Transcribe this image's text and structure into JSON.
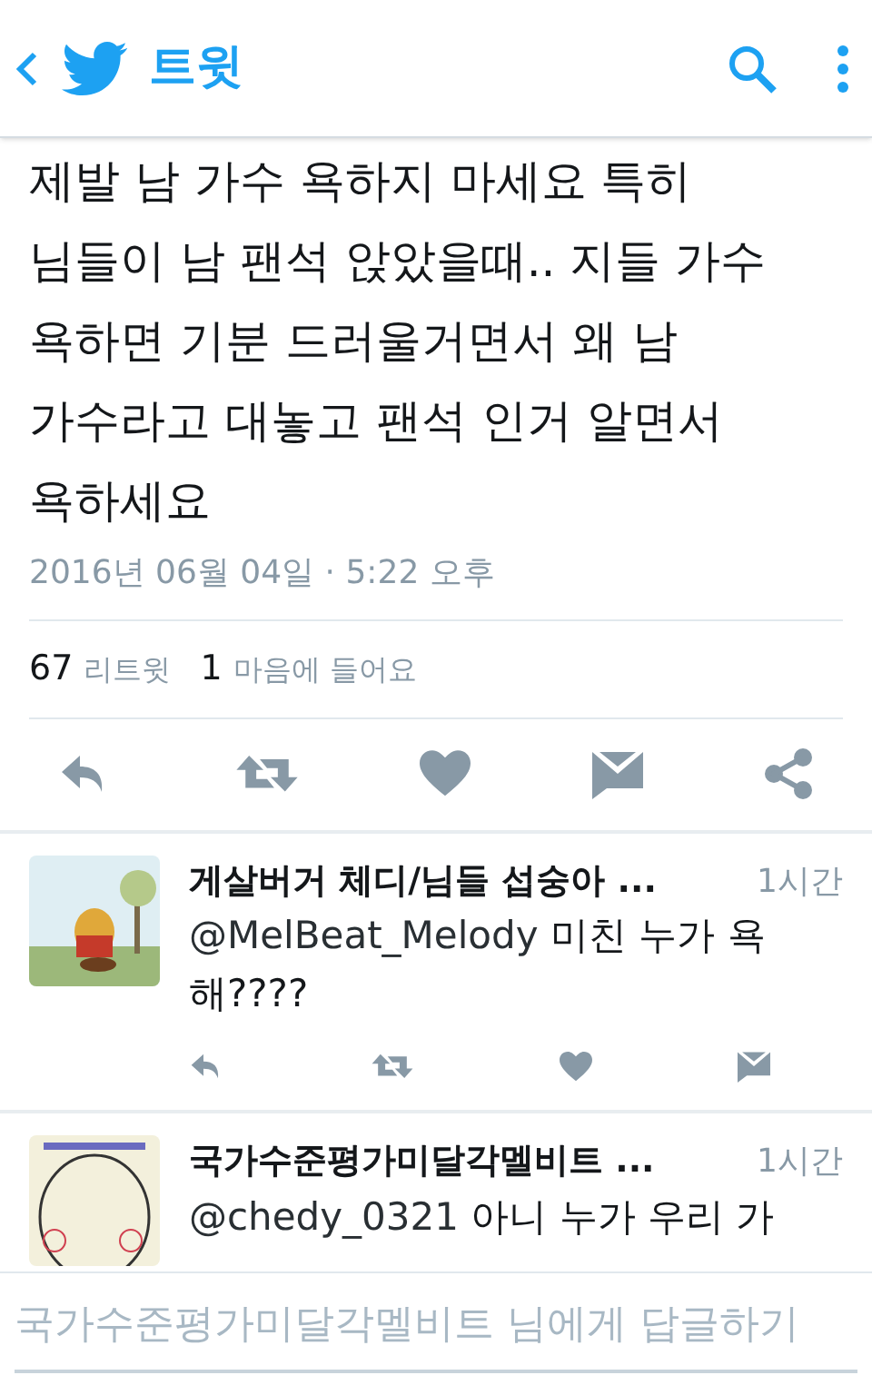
{
  "header": {
    "title": "트윗"
  },
  "tweet": {
    "lines": [
      "제발 남 가수 욕하지 마세요 특히",
      "님들이 남 팬석 앉았을때.. 지들 가수",
      "욕하면 기분 드러울거면서 왜 남",
      "가수라고 대놓고 팬석 인거 알면서",
      "욕하세요"
    ],
    "date": "2016년 06월 04일 · 5:22 오후",
    "stats": [
      {
        "count": "67",
        "label": "리트윗"
      },
      {
        "count": "1",
        "label": "마음에 들어요"
      }
    ]
  },
  "replies": [
    {
      "name": "게살버거 체디/님들 섭숭아 ...",
      "time": "1시간",
      "mention": "@MelBeat_Melody",
      "text": "미친 누가 욕해????",
      "actions": true
    },
    {
      "name": "국가수준평가미달각멜비트 ...",
      "time": "1시간",
      "mention": "@chedy_0321",
      "text": "아니 누가 우리 가",
      "actions": false
    }
  ],
  "reply_field": {
    "placeholder": "국가수준평가미달각멜비트 님에게 답글하기"
  }
}
